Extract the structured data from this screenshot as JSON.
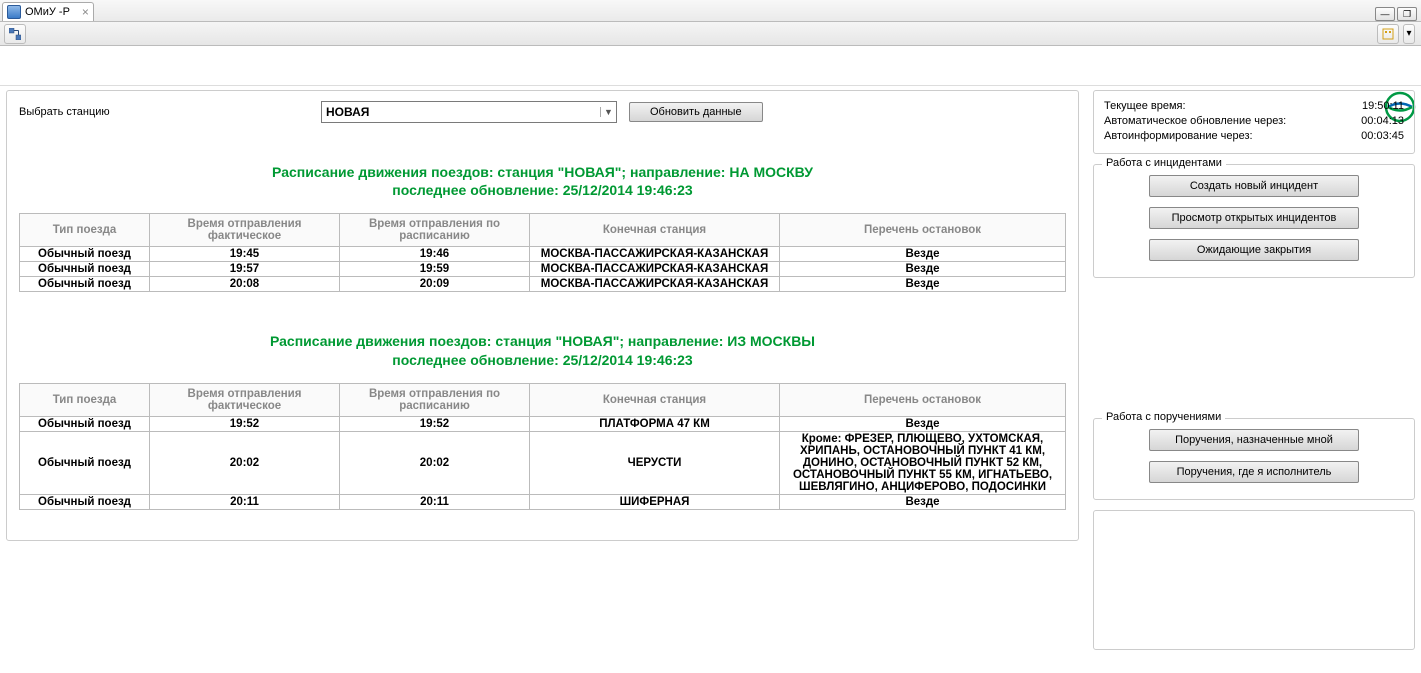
{
  "tab": {
    "title": "ОМиУ -Р"
  },
  "controls": {
    "station_label": "Выбрать станцию",
    "station_value": "НОВАЯ",
    "refresh_label": "Обновить данные"
  },
  "info": {
    "rows": [
      {
        "label": "Текущее время:",
        "value": "19:50:11"
      },
      {
        "label": "Автоматическое обновление через:",
        "value": "00:04:13"
      },
      {
        "label": "Автоинформирование через:",
        "value": "00:03:45"
      }
    ]
  },
  "incidents": {
    "legend": "Работа с инцидентами",
    "buttons": [
      "Создать новый инцидент",
      "Просмотр открытых инцидентов",
      "Ожидающие закрытия"
    ]
  },
  "tasks": {
    "legend": "Работа с поручениями",
    "buttons": [
      "Поручения, назначенные мной",
      "Поручения, где я исполнитель"
    ]
  },
  "columns": {
    "type": "Тип поезда",
    "actual": "Время отправления фактическое",
    "scheduled": "Время отправления по расписанию",
    "dest": "Конечная станция",
    "stops": "Перечень остановок"
  },
  "schedule_to": {
    "title_line1": "Расписание движения поездов: станция \"НОВАЯ\"; направление: НА МОСКВУ",
    "title_line2": "последнее обновление: 25/12/2014 19:46:23",
    "rows": [
      {
        "type": "Обычный поезд",
        "actual": "19:45",
        "scheduled": "19:46",
        "dest": "МОСКВА-ПАССАЖИРСКАЯ-КАЗАНСКАЯ",
        "stops": "Везде"
      },
      {
        "type": "Обычный поезд",
        "actual": "19:57",
        "scheduled": "19:59",
        "dest": "МОСКВА-ПАССАЖИРСКАЯ-КАЗАНСКАЯ",
        "stops": "Везде"
      },
      {
        "type": "Обычный поезд",
        "actual": "20:08",
        "scheduled": "20:09",
        "dest": "МОСКВА-ПАССАЖИРСКАЯ-КАЗАНСКАЯ",
        "stops": "Везде"
      }
    ]
  },
  "schedule_from": {
    "title_line1": "Расписание движения поездов: станция \"НОВАЯ\"; направление: ИЗ МОСКВЫ",
    "title_line2": "последнее обновление: 25/12/2014 19:46:23",
    "rows": [
      {
        "type": "Обычный поезд",
        "actual": "19:52",
        "scheduled": "19:52",
        "dest": "ПЛАТФОРМА 47 КМ",
        "stops": "Везде"
      },
      {
        "type": "Обычный поезд",
        "actual": "20:02",
        "scheduled": "20:02",
        "dest": "ЧЕРУСТИ",
        "stops": "Кроме: ФРЕЗЕР, ПЛЮЩЕВО, УХТОМСКАЯ, ХРИПАНЬ, ОСТАНОВОЧНЫЙ ПУНКТ 41 КМ, ДОНИНО, ОСТАНОВОЧНЫЙ ПУНКТ 52 КМ, ОСТАНОВОЧНЫЙ ПУНКТ 55 КМ, ИГНАТЬЕВО, ШЕВЛЯГИНО, АНЦИФЕРОВО, ПОДОСИНКИ"
      },
      {
        "type": "Обычный поезд",
        "actual": "20:11",
        "scheduled": "20:11",
        "dest": "ШИФЕРНАЯ",
        "stops": "Везде"
      }
    ]
  }
}
